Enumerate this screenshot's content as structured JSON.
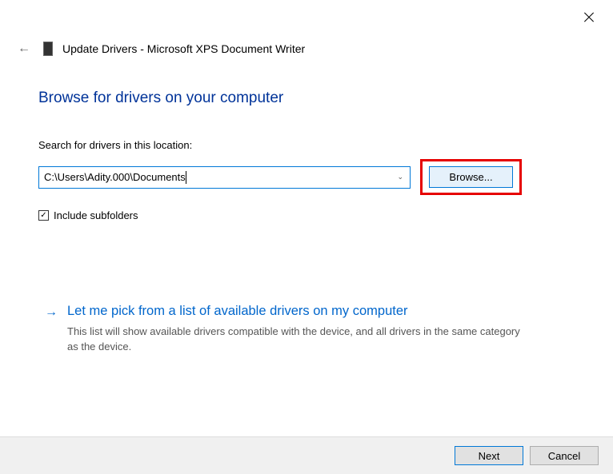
{
  "window": {
    "title": "Update Drivers - Microsoft XPS Document Writer"
  },
  "page": {
    "heading": "Browse for drivers on your computer",
    "search_label": "Search for drivers in this location:",
    "path_value": "C:\\Users\\Adity.000\\Documents",
    "browse_label": "Browse...",
    "include_subfolders_label": "Include subfolders",
    "include_subfolders_checked": true
  },
  "option": {
    "title": "Let me pick from a list of available drivers on my computer",
    "description": "This list will show available drivers compatible with the device, and all drivers in the same category as the device."
  },
  "footer": {
    "next_label": "Next",
    "cancel_label": "Cancel"
  }
}
